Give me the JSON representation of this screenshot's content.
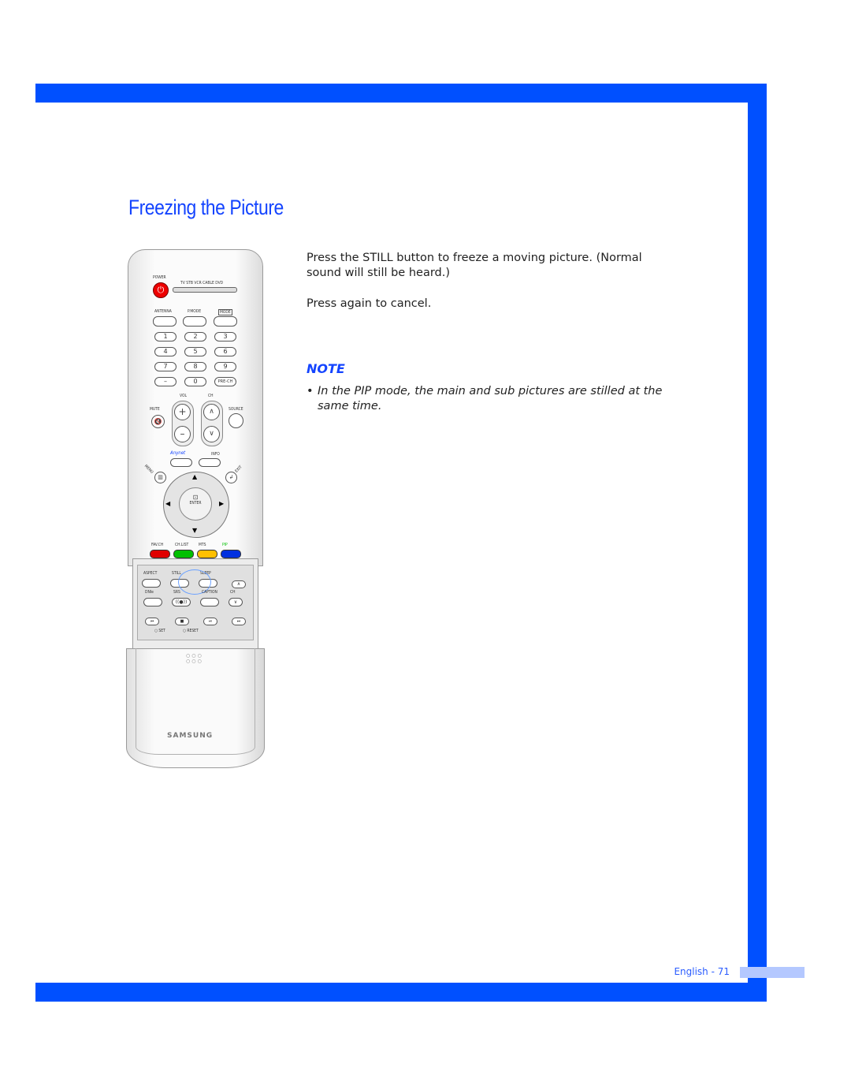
{
  "colors": {
    "accent": "#0050ff",
    "title": "#1444ff",
    "page_tab": "#b4c8ff"
  },
  "title": "Freezing the Picture",
  "paragraphs": [
    "Press the STILL button to freeze a moving picture. (Normal sound will still be heard.)",
    "Press again to cancel."
  ],
  "note": {
    "heading": "NOTE",
    "bullet": "•",
    "items": [
      "In the PIP mode, the main and sub pictures are stilled at the same time."
    ]
  },
  "footer": {
    "page_label": "English - 71"
  },
  "remote": {
    "power_label": "POWER",
    "source_modes": "TV  STB  VCR  CABLE  DVD",
    "row1": [
      "ANTENNA",
      "P.MODE",
      "MODE"
    ],
    "digits": [
      "1",
      "2",
      "3",
      "4",
      "5",
      "6",
      "7",
      "8",
      "9",
      "–",
      "0",
      "PRE-CH"
    ],
    "vol_label": "VOL",
    "ch_label": "CH",
    "mute_label": "MUTE",
    "source_label": "SOURCE",
    "anynet_label": "Anynet",
    "info_label": "INFO",
    "menu_label": "MENU",
    "exit_label": "EXIT",
    "enter_label": "ENTER",
    "color_labels": [
      "FAV.CH",
      "CH.LIST",
      "MTS",
      "PIP"
    ],
    "color_values": [
      "#e00000",
      "#00c000",
      "#ffc000",
      "#0030e0"
    ],
    "panel_row1": [
      "ASPECT",
      "STILL",
      "SLEEP"
    ],
    "panel_row2": [
      "DNIe",
      "SRS",
      "CAPTION",
      "CH"
    ],
    "set_label": "SET",
    "reset_label": "RESET",
    "brand": "SAMSUNG",
    "highlighted_button": "STILL"
  }
}
